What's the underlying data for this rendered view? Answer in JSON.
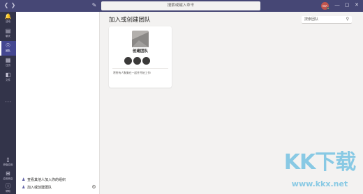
{
  "titlebar": {
    "back_icon": "chevron-left-icon",
    "forward_icon": "chevron-right-icon",
    "compose_icon": "new-chat-icon",
    "search_placeholder": "搜索或键入命令",
    "avatar_initials": "MA",
    "avatar_color": "#c2554d",
    "presence_color": "#92c353",
    "window_controls": [
      "minimize",
      "maximize",
      "close"
    ]
  },
  "appbar": {
    "items": [
      {
        "label": "活动",
        "icon": "bell-icon",
        "active": false
      },
      {
        "label": "聊天",
        "icon": "chat-icon",
        "active": false
      },
      {
        "label": "团队",
        "icon": "teams-icon",
        "active": true
      },
      {
        "label": "日历",
        "icon": "calendar-icon",
        "active": false
      },
      {
        "label": "文件",
        "icon": "file-icon",
        "active": false
      }
    ],
    "more_label": "···",
    "bottom_items": [
      {
        "label": "获取应用",
        "icon": "phone-icon"
      },
      {
        "label": "应用商店",
        "icon": "store-icon"
      },
      {
        "label": "帮助",
        "icon": "help-icon"
      }
    ],
    "accent": "#464775",
    "active_bg": "#444791"
  },
  "left_panel": {
    "discover_label": "查看其他人加入你的组织",
    "join_create_label": "加入或创建团队",
    "settings_icon": "gear-icon"
  },
  "main": {
    "title": "加入或创建团队",
    "search_placeholder": "搜索团队",
    "card": {
      "title": "创建团队",
      "description": "将所有人聚集在一起并开始工作!"
    }
  },
  "watermark": {
    "text": "KK下载",
    "url": "www.kkx.net"
  }
}
